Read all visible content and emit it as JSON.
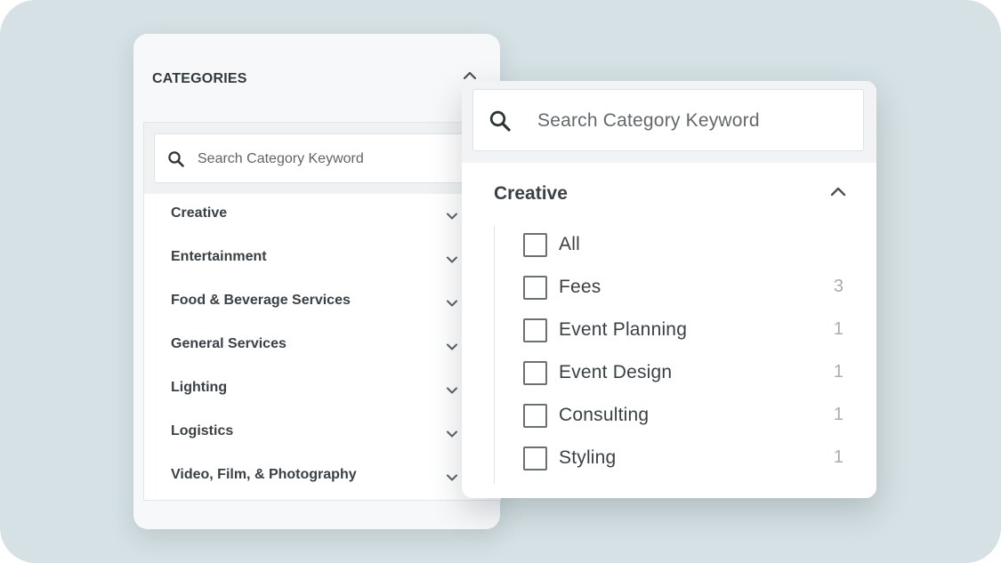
{
  "back_panel": {
    "header": "CATEGORIES",
    "search": {
      "placeholder": "Search Category Keyword"
    },
    "categories": [
      {
        "label": "Creative"
      },
      {
        "label": "Entertainment"
      },
      {
        "label": "Food & Beverage Services"
      },
      {
        "label": "General Services"
      },
      {
        "label": "Lighting"
      },
      {
        "label": "Logistics"
      },
      {
        "label": "Video, Film, & Photography"
      }
    ]
  },
  "front_panel": {
    "search": {
      "placeholder": "Search Category Keyword"
    },
    "category_title": "Creative",
    "options": [
      {
        "label": "All",
        "count": "",
        "checked": false
      },
      {
        "label": "Fees",
        "count": "3",
        "checked": false
      },
      {
        "label": "Event Planning",
        "count": "1",
        "checked": false
      },
      {
        "label": "Event Design",
        "count": "1",
        "checked": false
      },
      {
        "label": "Consulting",
        "count": "1",
        "checked": false
      },
      {
        "label": "Styling",
        "count": "1",
        "checked": false
      }
    ]
  },
  "icons": {
    "search": "search-icon",
    "expand": "chevron-down-icon",
    "collapse": "chevron-up-icon"
  },
  "colors": {
    "background": "#d5e1e4",
    "text": "#3a4045",
    "muted": "#a8adb1",
    "checkbox_border": "#6b7074"
  }
}
